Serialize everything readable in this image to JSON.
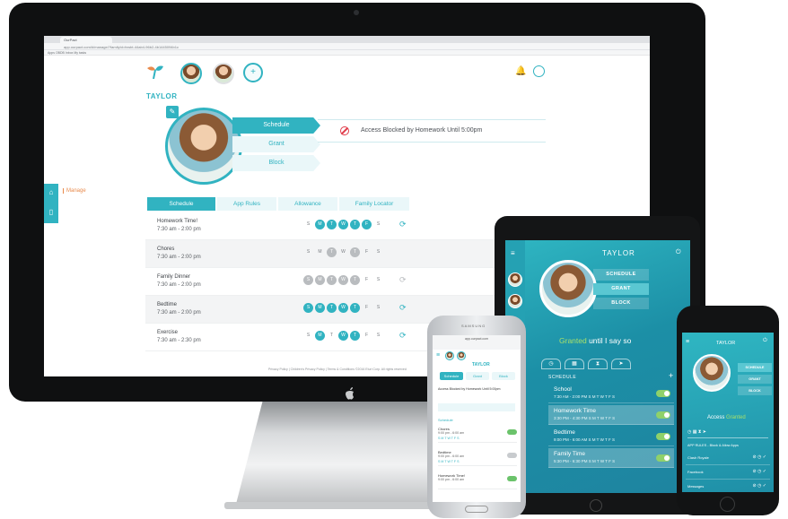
{
  "desktop": {
    "browser_tab": "OurPact",
    "url": "app.ourpact.com/#/manage/?familyId=fxwbt-44ab4-96b2-4b1445094b1c",
    "bookmarks": "Apps  OBDB  Inbox  My tasks",
    "child_name": "TAYLOR",
    "options": [
      "Schedule",
      "Grant",
      "Block"
    ],
    "status_text": "Access Blocked by Homework Until 5:00pm",
    "sidebar_label": "Manage",
    "tabs": [
      "Schedule",
      "App Rules",
      "Allowance",
      "Family Locator"
    ],
    "schedules": [
      {
        "name": "Homework Time!",
        "time": "7:30 am - 2:00 pm",
        "days": [
          "S",
          "M",
          "T",
          "W",
          "T",
          "F",
          "S"
        ],
        "active": [
          1,
          2,
          3,
          4,
          5
        ],
        "state": "on"
      },
      {
        "name": "Chores",
        "time": "7:30 am - 2:00 pm",
        "days": [
          "S",
          "M",
          "T",
          "W",
          "T",
          "F",
          "S"
        ],
        "active": [
          2,
          4
        ],
        "state": "dim"
      },
      {
        "name": "Family Dinner",
        "time": "7:30 am - 2:00 pm",
        "days": [
          "S",
          "M",
          "T",
          "W",
          "T",
          "F",
          "S"
        ],
        "active": [
          0,
          1,
          2,
          3,
          4
        ],
        "state": "dim"
      },
      {
        "name": "Bedtime",
        "time": "7:30 am - 2:00 pm",
        "days": [
          "S",
          "M",
          "T",
          "W",
          "T",
          "F",
          "S"
        ],
        "active": [
          0,
          1,
          2,
          3,
          4
        ],
        "state": "on"
      },
      {
        "name": "Exercise",
        "time": "7:30 am - 2:30 pm",
        "days": [
          "S",
          "M",
          "T",
          "W",
          "T",
          "F",
          "S"
        ],
        "active": [
          1,
          3,
          4
        ],
        "state": "on"
      }
    ],
    "footer": "Privacy Policy | Children's Privacy Policy | Terms & Conditions   ©2016 Eturi Corp. All rights reserved"
  },
  "ipad": {
    "title": "TAYLOR",
    "options": [
      "SCHEDULE",
      "GRANT",
      "BLOCK"
    ],
    "granted_word": "Granted",
    "granted_rest": " until I say so",
    "section": "SCHEDULE",
    "rows": [
      {
        "name": "School",
        "time": "7:30 AM - 2:00 PM  S M T W T F S",
        "on": true,
        "hl": false
      },
      {
        "name": "Homework Time",
        "time": "3:30 PM - 4:30 PM  S M T W T F S",
        "on": true,
        "hl": true
      },
      {
        "name": "Bedtime",
        "time": "9:00 PM - 6:00 AM  S M T W T F S",
        "on": true,
        "hl": false
      },
      {
        "name": "Family Time",
        "time": "5:30 PM - 6:30 PM  S M T W T F S",
        "on": true,
        "hl": true
      }
    ]
  },
  "samsung": {
    "brand": "SAMSUNG",
    "url": "app.ourpact.com",
    "title": "TAYLOR",
    "options": [
      "Schedule",
      "Grant",
      "Block"
    ],
    "status_text": "Access Blocked by Homework Until 5:00pm",
    "section": "Schedule",
    "rows": [
      {
        "name": "Chores",
        "time": "9:00 pm - 6:00 am",
        "days": "S M T W T F S",
        "on": true
      },
      {
        "name": "Bedtime",
        "time": "9:00 pm - 6:00 am",
        "days": "S M T W T F S",
        "on": false
      },
      {
        "name": "Homework Time!",
        "time": "9:00 pm - 6:00 am",
        "days": "",
        "on": true
      }
    ]
  },
  "iphone": {
    "title": "TAYLOR",
    "options": [
      "SCHEDULE",
      "GRANT",
      "BLOCK"
    ],
    "access_word": "Access ",
    "access_state": "Granted",
    "apps_header": "APP RULES - Block & Allow Apps",
    "apps": [
      "Clash Royale",
      "Facebook",
      "Messages"
    ]
  },
  "colors": {
    "brand": "#31b3c1",
    "accent": "#e88a4c",
    "granted": "#a8e06a",
    "blocked": "#e03c4a"
  }
}
